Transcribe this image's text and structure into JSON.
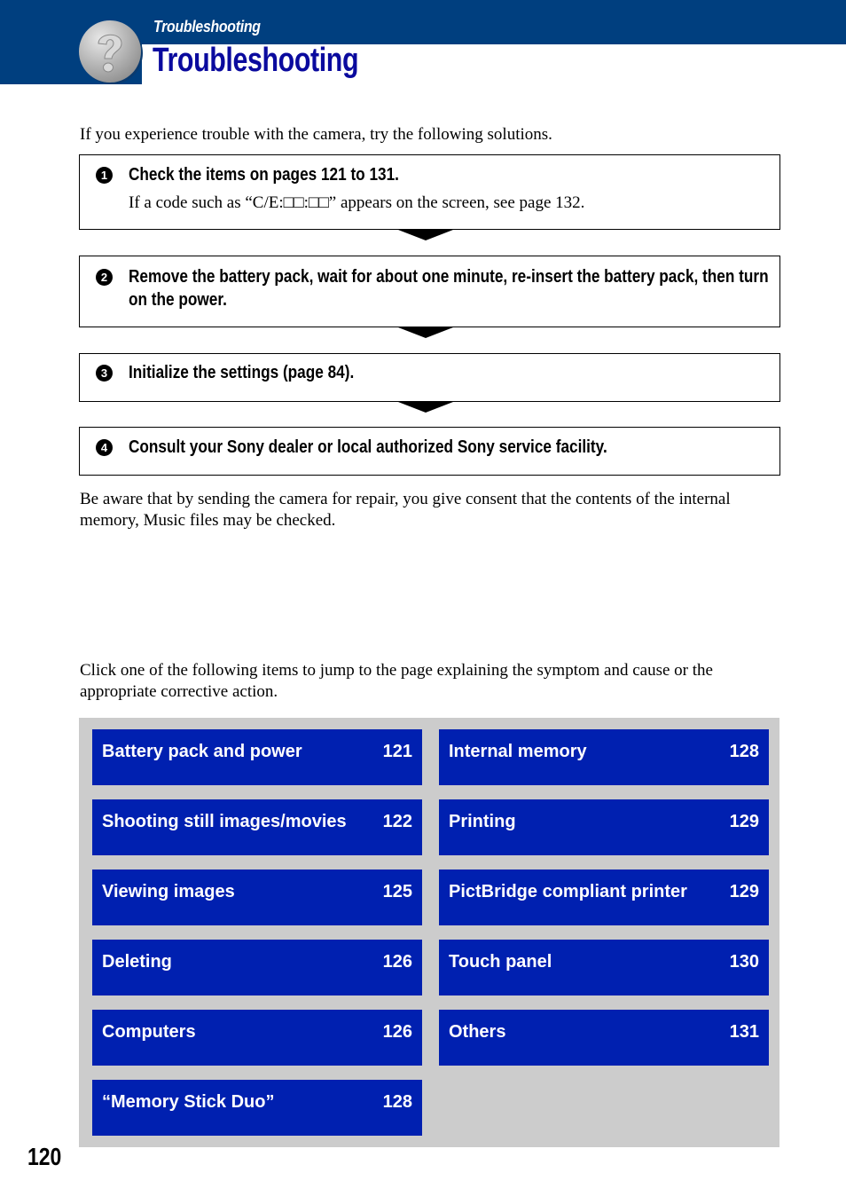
{
  "header": {
    "section_label": "Troubleshooting",
    "title": "Troubleshooting",
    "icon": "question-mark-icon",
    "band_color": "#003f7f",
    "title_color": "#0a0a9e"
  },
  "intro": "If you experience trouble with the camera, try the following solutions.",
  "steps": [
    {
      "number": "1",
      "text": "Check the items on pages 121 to 131.",
      "subtext": "If a code such as “C/E:□□:□□” appears on the screen, see page 132."
    },
    {
      "number": "2",
      "text": "Remove the battery pack, wait for about one minute, re-insert the battery pack, then turn on the power."
    },
    {
      "number": "3",
      "text": "Initialize the settings (page 84)."
    },
    {
      "number": "4",
      "text": "Consult your Sony dealer or local authorized Sony service facility."
    }
  ],
  "repair_note": "Be aware that by sending the camera for repair, you give consent that the contents of the internal memory, Music files may be checked.",
  "jump_intro": "Click one of the following items to jump to the page explaining the symptom and cause or the appropriate corrective action.",
  "symptoms": {
    "tile_color": "#0020b0",
    "background_color": "#cccccc",
    "left": [
      {
        "label": "Battery pack and power",
        "page": "121"
      },
      {
        "label": "Shooting still images/movies",
        "page": "122"
      },
      {
        "label": "Viewing images",
        "page": "125"
      },
      {
        "label": "Deleting",
        "page": "126"
      },
      {
        "label": "Computers",
        "page": "126"
      },
      {
        "label": "“Memory Stick Duo”",
        "page": "128"
      }
    ],
    "right": [
      {
        "label": "Internal memory",
        "page": "128"
      },
      {
        "label": "Printing",
        "page": "129"
      },
      {
        "label": "PictBridge compliant printer",
        "page": "129"
      },
      {
        "label": "Touch panel",
        "page": "130"
      },
      {
        "label": "Others",
        "page": "131"
      }
    ]
  },
  "page_number": "120"
}
